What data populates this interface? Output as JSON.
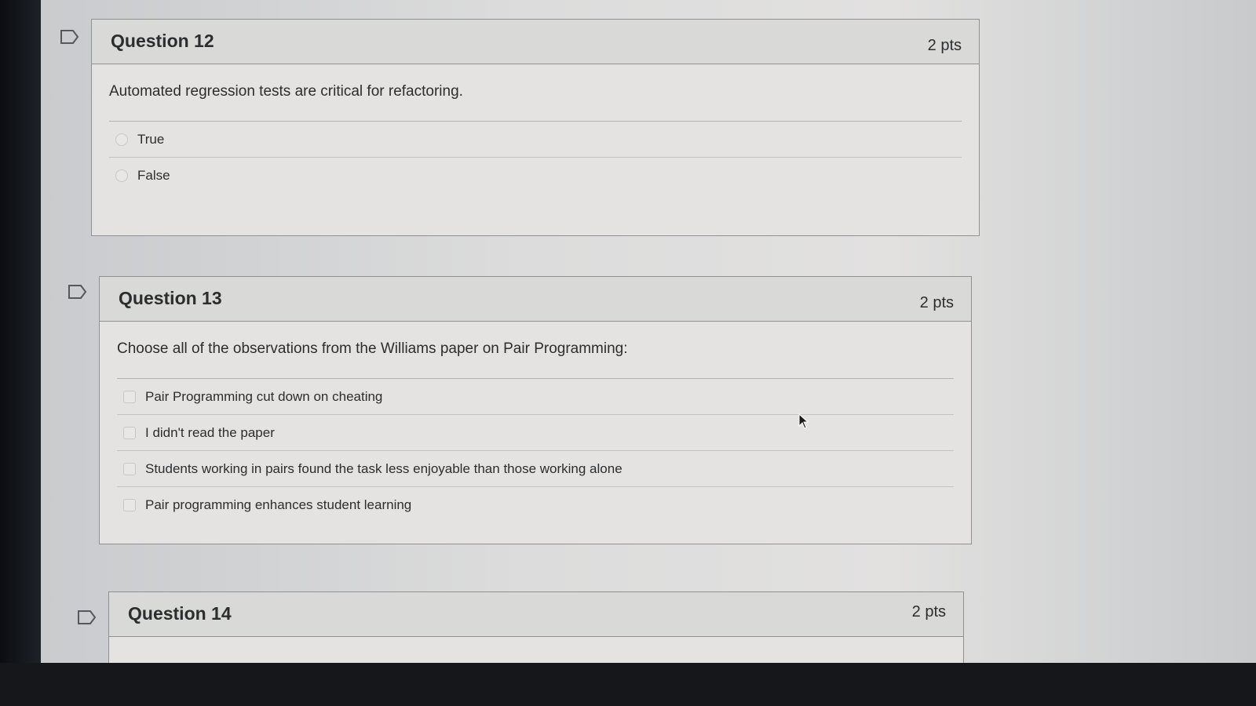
{
  "questions": [
    {
      "title": "Question 12",
      "points": "2 pts",
      "text": "Automated regression tests are critical for refactoring.",
      "answer_type": "radio",
      "answers": [
        "True",
        "False"
      ]
    },
    {
      "title": "Question 13",
      "points": "2 pts",
      "text": "Choose all of the observations from the Williams paper on Pair Programming:",
      "answer_type": "checkbox",
      "answers": [
        "Pair Programming cut down on cheating",
        "I didn't read the paper",
        "Students working in pairs found the task less enjoyable than those working alone",
        "Pair programming enhances student learning"
      ]
    },
    {
      "title": "Question 14",
      "points": "2 pts"
    }
  ],
  "icons": {
    "flag": "flag-icon",
    "cursor": "mouse-pointer-icon"
  }
}
